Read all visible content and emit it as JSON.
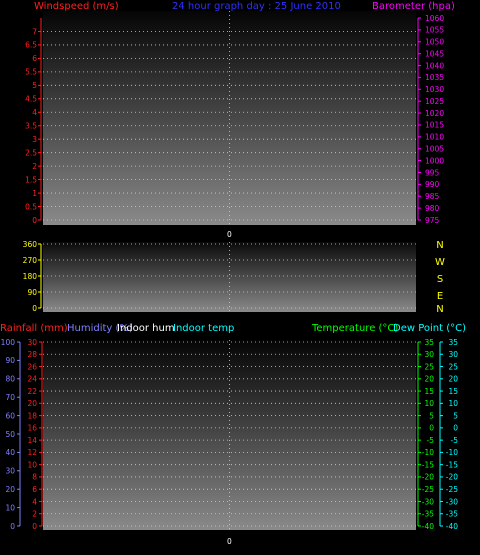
{
  "colors": {
    "background": "#000000",
    "windspeed": "#ff2020",
    "barometer": "#ff00ff",
    "title": "#3030ff",
    "direction": "#ffff00",
    "rainfall": "#ff2020",
    "humidity": "#8080ff",
    "indoor_hum": "#ffffff",
    "indoor_temp": "#00ffff",
    "temperature": "#00ff00",
    "dew_point": "#00ffff",
    "grid": "#d0d0d0"
  },
  "chart_data": [
    {
      "type": "line",
      "title": "24 hour graph day : 25 June 2010",
      "left_axis": {
        "label": "Windspeed (m/s)",
        "ylim": [
          0,
          7.5
        ],
        "ticks": [
          "0",
          "0.5",
          "1",
          "1.5",
          "2",
          "2.5",
          "3",
          "3.5",
          "4",
          "4.5",
          "5",
          "5.5",
          "6",
          "6.5",
          "7"
        ]
      },
      "right_axis": {
        "label": "Barometer (hpa)",
        "ylim": [
          975,
          1060
        ],
        "ticks": [
          "975",
          "980",
          "985",
          "990",
          "995",
          "1000",
          "1005",
          "1010",
          "1015",
          "1020",
          "1025",
          "1030",
          "1035",
          "1040",
          "1045",
          "1050",
          "1055",
          "1060"
        ]
      },
      "x_ticks": [
        "0"
      ],
      "grid": true,
      "series": []
    },
    {
      "type": "line",
      "left_axis": {
        "ylim": [
          0,
          360
        ],
        "ticks": [
          "0",
          "90",
          "180",
          "270",
          "360"
        ]
      },
      "compass_labels": [
        "N",
        "W",
        "S",
        "E",
        "N"
      ],
      "grid": true,
      "series": []
    },
    {
      "type": "line",
      "legend": [
        "Rainfall (mm)",
        "Humidity (%)",
        "Indoor hum",
        "Indoor temp",
        "Temperature (°C)",
        "Dew Point (°C)"
      ],
      "humidity_axis": {
        "ylim": [
          0,
          100
        ],
        "ticks": [
          "0",
          "10",
          "20",
          "30",
          "40",
          "50",
          "60",
          "70",
          "80",
          "90",
          "100"
        ]
      },
      "rainfall_axis": {
        "ylim": [
          0,
          30
        ],
        "ticks": [
          "0",
          "2",
          "4",
          "6",
          "8",
          "10",
          "12",
          "14",
          "16",
          "18",
          "20",
          "22",
          "24",
          "26",
          "28",
          "30"
        ]
      },
      "temperature_axis": {
        "ylim": [
          -40,
          35
        ],
        "ticks": [
          "-40",
          "-35",
          "-30",
          "-25",
          "-20",
          "-15",
          "-10",
          "-5",
          "0",
          "5",
          "10",
          "15",
          "20",
          "25",
          "30",
          "35"
        ]
      },
      "dewpoint_axis": {
        "ylim": [
          -40,
          35
        ],
        "ticks": [
          "-40",
          "-35",
          "-30",
          "-25",
          "-20",
          "-15",
          "-10",
          "-5",
          "0",
          "5",
          "10",
          "15",
          "20",
          "25",
          "30",
          "35"
        ]
      },
      "x_ticks": [
        "0"
      ],
      "grid": true,
      "series": []
    }
  ]
}
